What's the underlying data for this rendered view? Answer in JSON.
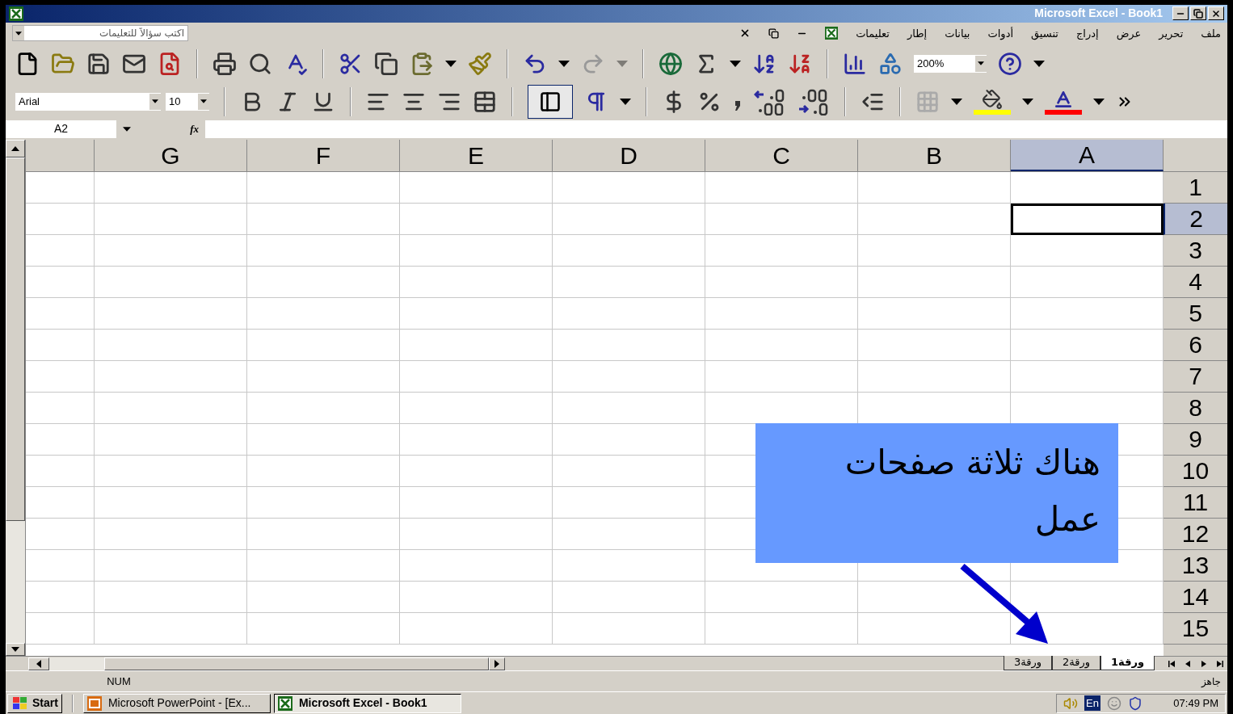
{
  "window": {
    "title": "Microsoft Excel - Book1"
  },
  "menu_bar": {
    "items": [
      "ملف",
      "تحرير",
      "عرض",
      "إدراج",
      "تنسيق",
      "أدوات",
      "بيانات",
      "إطار",
      "تعليمات"
    ],
    "ask_box": {
      "placeholder": "اكتب سؤالاً للتعليمات"
    }
  },
  "standard_toolbar": {
    "zoom": "200%"
  },
  "formatting_toolbar": {
    "font": "Arial",
    "size": "10"
  },
  "formula_bar": {
    "name_box": "A2",
    "fx": "fx"
  },
  "sheet": {
    "columns": [
      {
        "label": "A",
        "selected": true
      },
      {
        "label": "B",
        "selected": false
      },
      {
        "label": "C",
        "selected": false
      },
      {
        "label": "D",
        "selected": false
      },
      {
        "label": "E",
        "selected": false
      },
      {
        "label": "F",
        "selected": false
      },
      {
        "label": "G",
        "selected": false
      }
    ],
    "rows": [
      {
        "label": "1",
        "selected": false
      },
      {
        "label": "2",
        "selected": true
      },
      {
        "label": "3",
        "selected": false
      },
      {
        "label": "4",
        "selected": false
      },
      {
        "label": "5",
        "selected": false
      },
      {
        "label": "6",
        "selected": false
      },
      {
        "label": "7",
        "selected": false
      },
      {
        "label": "8",
        "selected": false
      },
      {
        "label": "9",
        "selected": false
      },
      {
        "label": "10",
        "selected": false
      },
      {
        "label": "11",
        "selected": false
      },
      {
        "label": "12",
        "selected": false
      },
      {
        "label": "13",
        "selected": false
      },
      {
        "label": "14",
        "selected": false
      },
      {
        "label": "15",
        "selected": false
      }
    ]
  },
  "callout": {
    "text": "هناك ثلاثة صفحات عمل"
  },
  "sheet_tabs": [
    {
      "label": "ورقة1",
      "selected": true
    },
    {
      "label": "ورقة2",
      "selected": false
    },
    {
      "label": "ورقة3",
      "selected": false
    }
  ],
  "status_bar": {
    "status": "جاهز",
    "indicators": [
      "NUM"
    ]
  },
  "taskbar": {
    "start": "Start",
    "powerpoint_task": {
      "label": "Microsoft PowerPoint - [Ex...",
      "selected": false,
      "kind": "powerpoint"
    },
    "excel_task": {
      "label": "Microsoft Excel - Book1",
      "selected": true,
      "kind": "excel"
    },
    "language": "En",
    "clock": "07:49 PM"
  }
}
